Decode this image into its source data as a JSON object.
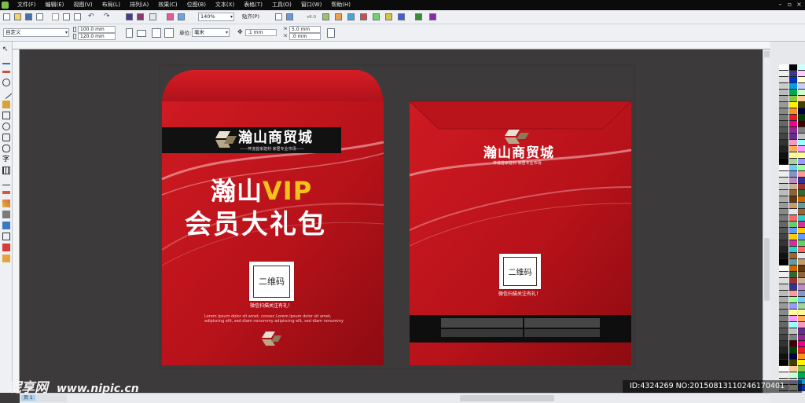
{
  "menu": [
    "文件(F)",
    "编辑(E)",
    "视图(V)",
    "布局(L)",
    "排列(A)",
    "效果(C)",
    "位图(B)",
    "文本(X)",
    "表格(T)",
    "工具(O)",
    "窗口(W)",
    "帮助(H)"
  ],
  "toolbar": {
    "zoom": "140%",
    "snap": "贴齐(P)",
    "version": "v6.0"
  },
  "property_bar": {
    "preset": "自定义",
    "width": "100.0 mm",
    "height": "120.0 mm",
    "units_label": "单位:",
    "units": "毫米",
    "nudge": ".1 mm",
    "dup_x": "5.0 mm",
    "dup_y": ".0 mm"
  },
  "front": {
    "brand": "瀚山商贸城",
    "brand_sub": "——梓潼首家建材·家居专业市场——",
    "vip_line_prefix": "瀚山",
    "vip_line_vip": "VIP",
    "gift_line": "会员大礼包",
    "qr_text": "二维码",
    "qr_caption": "微信扫描关注有礼！",
    "lorem_1": "Lorem ipsum dolor sit amet, consec Lorem ipsum dolor sit amet,",
    "lorem_2": "adipiscing elit, sed diam nonummy adipiscing elit, sed diam nonummy"
  },
  "back": {
    "brand": "瀚山商贸城",
    "brand_sub": "梓潼首家建材·家居专业市场",
    "qr_text": "二维码",
    "qr_caption": "微信扫描关注有礼！"
  },
  "watermark": {
    "logo": "昵享网",
    "url": "www.nipic.cn",
    "id_text": "ID:4324269 NO:20150813110246170401"
  },
  "page_tab": "页 1",
  "colors": {
    "envelope_red": "#c0141c",
    "envelope_dark": "#8e0d12",
    "vip_gold": "#f2c21b"
  }
}
